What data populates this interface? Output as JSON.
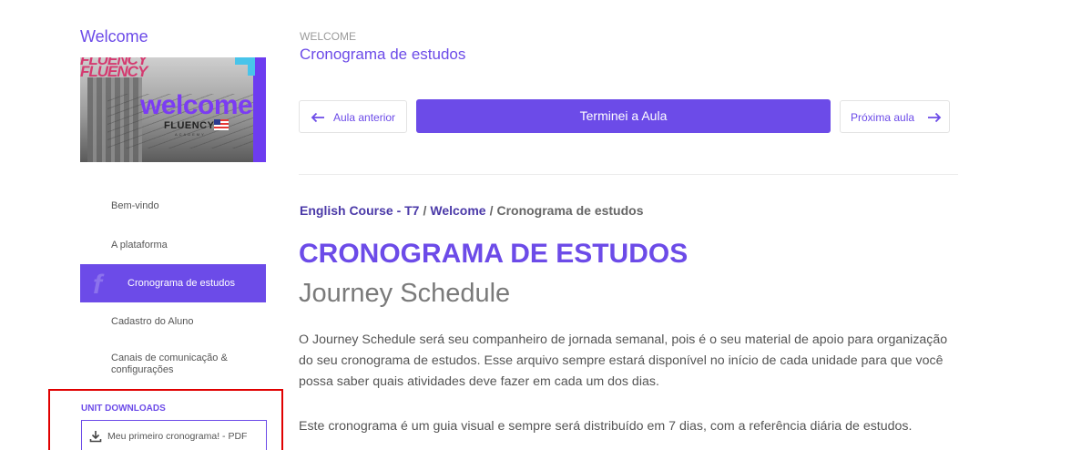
{
  "sidebar": {
    "title": "Welcome",
    "thumbnail": {
      "headline": "welcome",
      "brand": "FLUENCY",
      "bg_text": "FLUENCY",
      "tagline": "ACADEMY"
    },
    "nav_items": [
      {
        "label": "Bem-vindo"
      },
      {
        "label": "A plataforma"
      },
      {
        "label": "Cronograma de estudos",
        "active": true
      },
      {
        "label": "Cadastro do Aluno"
      },
      {
        "label": "Canais de comunicação & configurações"
      }
    ],
    "downloads": {
      "heading": "UNIT DOWNLOADS",
      "file_label": "Meu primeiro cronograma! - PDF",
      "icon": "download-icon"
    }
  },
  "header": {
    "module": "WELCOME",
    "lesson": "Cronograma de estudos"
  },
  "actions": {
    "prev_label": "Aula anterior",
    "done_label": "Terminei a Aula",
    "next_label": "Próxima aula"
  },
  "breadcrumb": {
    "course": "English Course - T7",
    "module": "Welcome",
    "current": "Cronograma de estudos",
    "separator": "/"
  },
  "content": {
    "heading": "CRONOGRAMA DE ESTUDOS",
    "subheading": "Journey Schedule",
    "paragraphs": [
      "O Journey Schedule será seu companheiro de jornada semanal, pois é o seu material de apoio para organização do seu cronograma de estudos. Esse arquivo sempre estará disponível no início de cada unidade para que você possa saber quais atividades deve fazer em cada um dos dias.",
      "Este cronograma é um guia visual e sempre será distribuído em 7 dias, com a referência diária de estudos."
    ]
  },
  "colors": {
    "accent": "#6c4be8",
    "highlight_box": "#e00000"
  }
}
